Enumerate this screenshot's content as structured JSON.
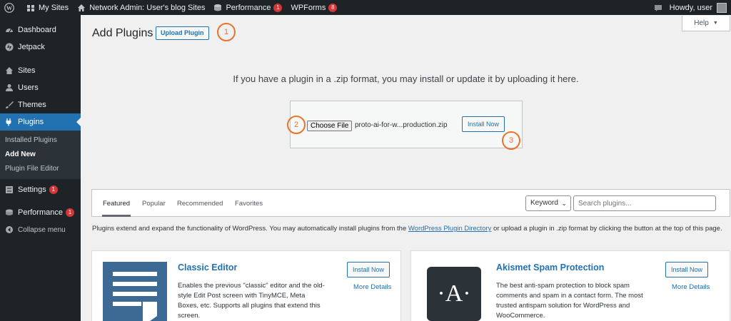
{
  "adminbar": {
    "my_sites": "My Sites",
    "network_admin": "Network Admin: User's blog Sites",
    "performance": "Performance",
    "performance_count": "1",
    "wpforms": "WPForms",
    "wpforms_count": "8",
    "howdy": "Howdy, user"
  },
  "sidebar": {
    "dashboard": "Dashboard",
    "jetpack": "Jetpack",
    "sites": "Sites",
    "users": "Users",
    "themes": "Themes",
    "plugins": "Plugins",
    "sub_installed": "Installed Plugins",
    "sub_add_new": "Add New",
    "sub_file_editor": "Plugin File Editor",
    "settings": "Settings",
    "settings_count": "1",
    "performance": "Performance",
    "performance_count": "1",
    "collapse": "Collapse menu"
  },
  "header": {
    "title": "Add Plugins",
    "upload_button": "Upload Plugin",
    "help": "Help"
  },
  "annotations": {
    "a1": "1",
    "a2": "2",
    "a3": "3"
  },
  "upload": {
    "instructions": "If you have a plugin in a .zip format, you may install or update it by uploading it here.",
    "choose_file": "Choose File",
    "file_name": "proto-ai-for-w...production.zip",
    "install_now": "Install Now"
  },
  "filters": {
    "tabs": [
      "Featured",
      "Popular",
      "Recommended",
      "Favorites"
    ],
    "keyword": "Keyword",
    "search_placeholder": "Search plugins..."
  },
  "description": {
    "before": "Plugins extend and expand the functionality of WordPress. You may automatically install plugins from the ",
    "link": "WordPress Plugin Directory",
    "after": " or upload a plugin in .zip format by clicking the button at the top of this page."
  },
  "plugins": [
    {
      "name": "Classic Editor",
      "description": "Enables the previous \"classic\" editor and the old-style Edit Post screen with TinyMCE, Meta Boxes, etc. Supports all plugins that extend this screen.",
      "install": "Install Now",
      "more": "More Details"
    },
    {
      "name": "Akismet Spam Protection",
      "description": "The best anti-spam protection to block spam comments and spam in a contact form. The most trusted antispam solution for WordPress and WooCommerce.",
      "install": "Install Now",
      "more": "More Details",
      "icon_letter": "·A·"
    }
  ],
  "colors": {
    "accent": "#2271b1",
    "annotation": "#e8742a",
    "adminbar": "#1d2327"
  }
}
